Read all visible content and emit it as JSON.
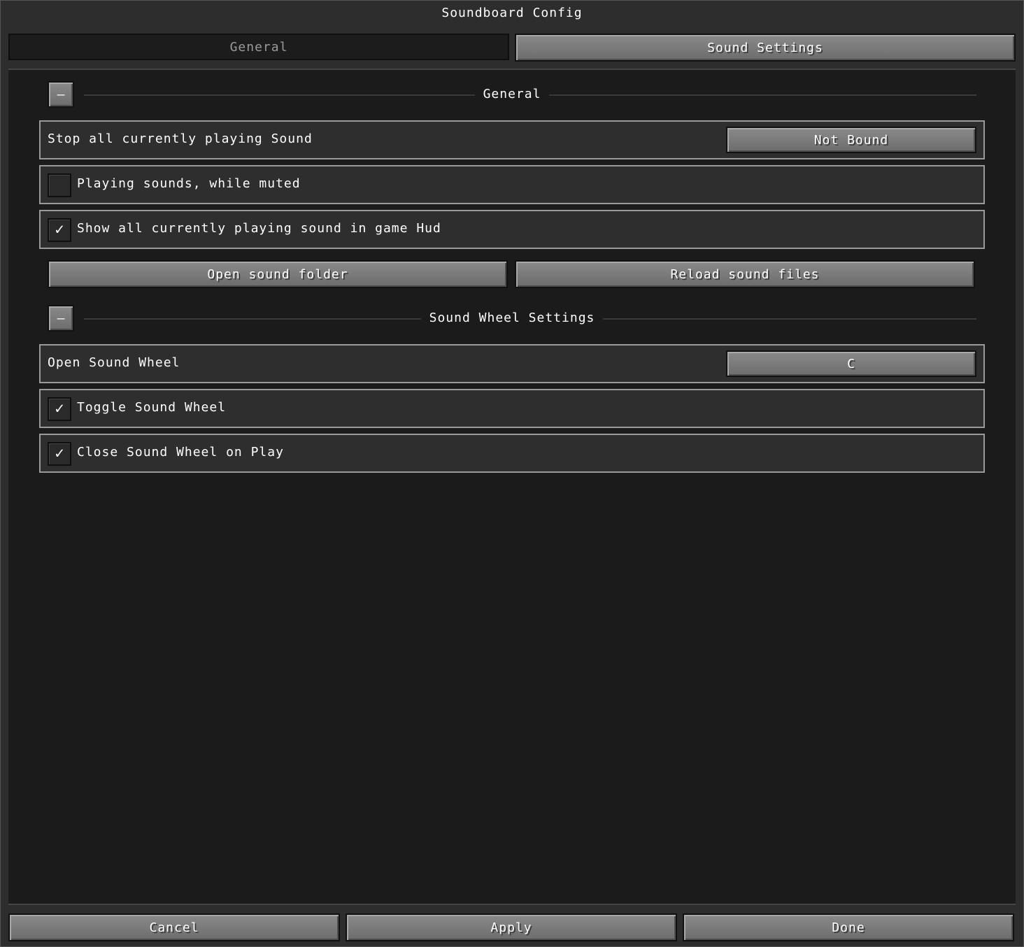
{
  "window": {
    "title": "Soundboard Config"
  },
  "tabs": [
    {
      "label": "General",
      "active": true
    },
    {
      "label": "Sound Settings",
      "active": false
    }
  ],
  "sections": [
    {
      "title": "General",
      "collapse_label": "–",
      "rows": [
        {
          "label": "Stop all currently playing Sound",
          "type": "keybind",
          "value": "Not Bound"
        },
        {
          "label": "Playing sounds, while muted",
          "type": "checkbox",
          "checked": false
        },
        {
          "label": "Show all currently playing sound in game Hud",
          "type": "checkbox",
          "checked": true
        }
      ],
      "buttons": [
        "Open sound folder",
        "Reload sound files"
      ]
    },
    {
      "title": "Sound Wheel Settings",
      "collapse_label": "–",
      "rows": [
        {
          "label": "Open Sound Wheel",
          "type": "keybind",
          "value": "C"
        },
        {
          "label": "Toggle Sound Wheel",
          "type": "checkbox",
          "checked": true
        },
        {
          "label": "Close Sound Wheel on Play",
          "type": "checkbox",
          "checked": true
        }
      ]
    }
  ],
  "checkmark_glyph": "✓",
  "footer": {
    "cancel": "Cancel",
    "apply": "Apply",
    "done": "Done"
  }
}
